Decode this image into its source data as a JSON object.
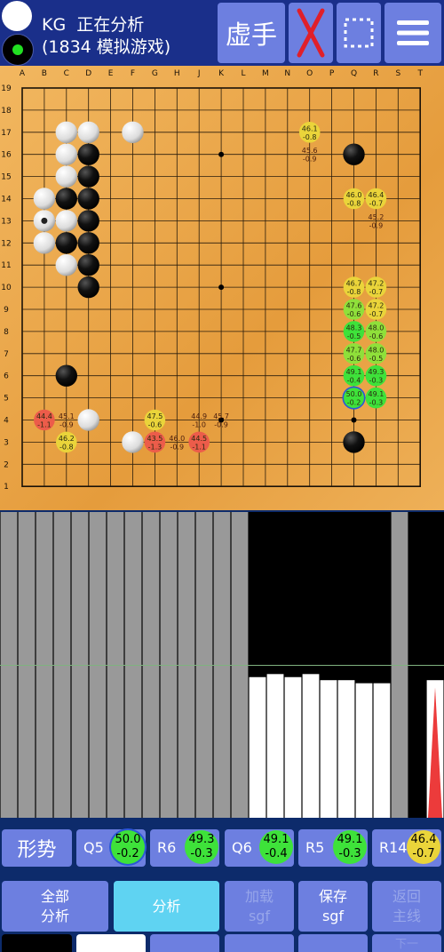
{
  "header": {
    "engine": "KG",
    "status": "正在分析",
    "subtitle": "(1834 模拟游戏)",
    "virtual_move_label": "虚手",
    "close_icon": "red-x-icon",
    "select_icon": "dotted-square-icon",
    "menu_icon": "hamburger-menu-icon"
  },
  "board": {
    "columns": [
      "A",
      "B",
      "C",
      "D",
      "E",
      "F",
      "G",
      "H",
      "J",
      "K",
      "L",
      "M",
      "N",
      "O",
      "P",
      "Q",
      "R",
      "S",
      "T"
    ],
    "rows": [
      "19",
      "18",
      "17",
      "16",
      "15",
      "14",
      "13",
      "12",
      "11",
      "10",
      "9",
      "8",
      "7",
      "6",
      "5",
      "4",
      "3",
      "2",
      "1"
    ],
    "stones": [
      {
        "p": "C17",
        "c": "w"
      },
      {
        "p": "D17",
        "c": "w"
      },
      {
        "p": "F17",
        "c": "w"
      },
      {
        "p": "C16",
        "c": "w"
      },
      {
        "p": "D16",
        "c": "b"
      },
      {
        "p": "C15",
        "c": "w"
      },
      {
        "p": "D15",
        "c": "b"
      },
      {
        "p": "B14",
        "c": "w"
      },
      {
        "p": "C14",
        "c": "b"
      },
      {
        "p": "D14",
        "c": "b"
      },
      {
        "p": "B13",
        "c": "w",
        "marker": true
      },
      {
        "p": "C13",
        "c": "w"
      },
      {
        "p": "D13",
        "c": "b"
      },
      {
        "p": "B12",
        "c": "w"
      },
      {
        "p": "C12",
        "c": "b"
      },
      {
        "p": "D12",
        "c": "b"
      },
      {
        "p": "C11",
        "c": "w"
      },
      {
        "p": "D11",
        "c": "b"
      },
      {
        "p": "D10",
        "c": "b"
      },
      {
        "p": "C6",
        "c": "b"
      },
      {
        "p": "D4",
        "c": "w"
      },
      {
        "p": "F3",
        "c": "w"
      },
      {
        "p": "Q16",
        "c": "b"
      },
      {
        "p": "Q3",
        "c": "b"
      }
    ],
    "candidates": [
      {
        "p": "O17",
        "wr": "46.1",
        "d": "-0.8",
        "col": "yellow"
      },
      {
        "p": "O16",
        "wr": "45.6",
        "d": "-0.9",
        "col": "none"
      },
      {
        "p": "Q14",
        "wr": "46.0",
        "d": "-0.8",
        "col": "yellow"
      },
      {
        "p": "R14",
        "wr": "46.4",
        "d": "-0.7",
        "col": "yellow"
      },
      {
        "p": "R13",
        "wr": "45.2",
        "d": "-0.9",
        "col": "none"
      },
      {
        "p": "Q10",
        "wr": "46.7",
        "d": "-0.8",
        "col": "yellow"
      },
      {
        "p": "R10",
        "wr": "47.2",
        "d": "-0.7",
        "col": "yellow"
      },
      {
        "p": "Q9",
        "wr": "47.6",
        "d": "-0.6",
        "col": "lime"
      },
      {
        "p": "R9",
        "wr": "47.2",
        "d": "-0.7",
        "col": "yellow"
      },
      {
        "p": "Q8",
        "wr": "48.3",
        "d": "-0.5",
        "col": "green"
      },
      {
        "p": "R8",
        "wr": "48.0",
        "d": "-0.6",
        "col": "lime"
      },
      {
        "p": "Q7",
        "wr": "47.7",
        "d": "-0.6",
        "col": "lime"
      },
      {
        "p": "R7",
        "wr": "48.0",
        "d": "-0.5",
        "col": "lime"
      },
      {
        "p": "Q6",
        "wr": "49.1",
        "d": "-0.4",
        "col": "green"
      },
      {
        "p": "R6",
        "wr": "49.3",
        "d": "-0.3",
        "col": "green"
      },
      {
        "p": "Q5",
        "wr": "50.0",
        "d": "-0.2",
        "col": "green",
        "best": true
      },
      {
        "p": "R5",
        "wr": "49.1",
        "d": "-0.3",
        "col": "green"
      },
      {
        "p": "B4",
        "wr": "44.4",
        "d": "-1.1",
        "col": "red"
      },
      {
        "p": "C4",
        "wr": "45.1",
        "d": "-0.9",
        "col": "none"
      },
      {
        "p": "G4",
        "wr": "47.5",
        "d": "-0.6",
        "col": "yellow"
      },
      {
        "p": "J4",
        "wr": "44.9",
        "d": "-1.0",
        "col": "none"
      },
      {
        "p": "K4",
        "wr": "45.7",
        "d": "-0.9",
        "col": "none"
      },
      {
        "p": "C3",
        "wr": "46.2",
        "d": "-0.8",
        "col": "yellow"
      },
      {
        "p": "G3",
        "wr": "43.5",
        "d": "-1.3",
        "col": "red"
      },
      {
        "p": "H3",
        "wr": "46.0",
        "d": "-0.9",
        "col": "none"
      },
      {
        "p": "J3",
        "wr": "44.5",
        "d": "-1.1",
        "col": "red"
      }
    ],
    "colors": {
      "red": "#ec5c4a",
      "yellow": "#ead43a",
      "lime": "#8fe03a",
      "green": "#3ee23a",
      "best_ring": "#2b57d6"
    }
  },
  "graph": {
    "bars": [
      0,
      0,
      0,
      0,
      0,
      0,
      0,
      0,
      0,
      0,
      0,
      0,
      0,
      0,
      0.46,
      0.47,
      0.46,
      0.47,
      0.45,
      0.45,
      0.44,
      0.44,
      0,
      0,
      0.45
    ],
    "bar_kinds": [
      "gray",
      "gray",
      "gray",
      "gray",
      "gray",
      "gray",
      "gray",
      "gray",
      "gray",
      "gray",
      "gray",
      "gray",
      "gray",
      "gray",
      "white",
      "white",
      "white",
      "white",
      "white",
      "white",
      "white",
      "white",
      "gray",
      "black",
      "red"
    ],
    "midline_color": "#7fb27f"
  },
  "moves": {
    "situation_label": "形势",
    "items": [
      {
        "label": "Q5",
        "wr": "50.0",
        "d": "-0.2",
        "col": "#3ee23a",
        "ring": true
      },
      {
        "label": "R6",
        "wr": "49.3",
        "d": "-0.3",
        "col": "#3ee23a",
        "ring": false
      },
      {
        "label": "Q6",
        "wr": "49.1",
        "d": "-0.4",
        "col": "#3ee23a",
        "ring": false
      },
      {
        "label": "R5",
        "wr": "49.1",
        "d": "-0.3",
        "col": "#3ee23a",
        "ring": false
      },
      {
        "label": "R14",
        "wr": "46.4",
        "d": "-0.7",
        "col": "#ead43a",
        "ring": false
      }
    ]
  },
  "toolbar": {
    "analyze_all_1": "全部",
    "analyze_all_2": "分析",
    "analyze": "分析",
    "load_1": "加载",
    "load_2": "sgf",
    "save_1": "保存",
    "save_2": "sgf",
    "return_1": "返回",
    "return_2": "主线",
    "next_partial": "下一"
  }
}
